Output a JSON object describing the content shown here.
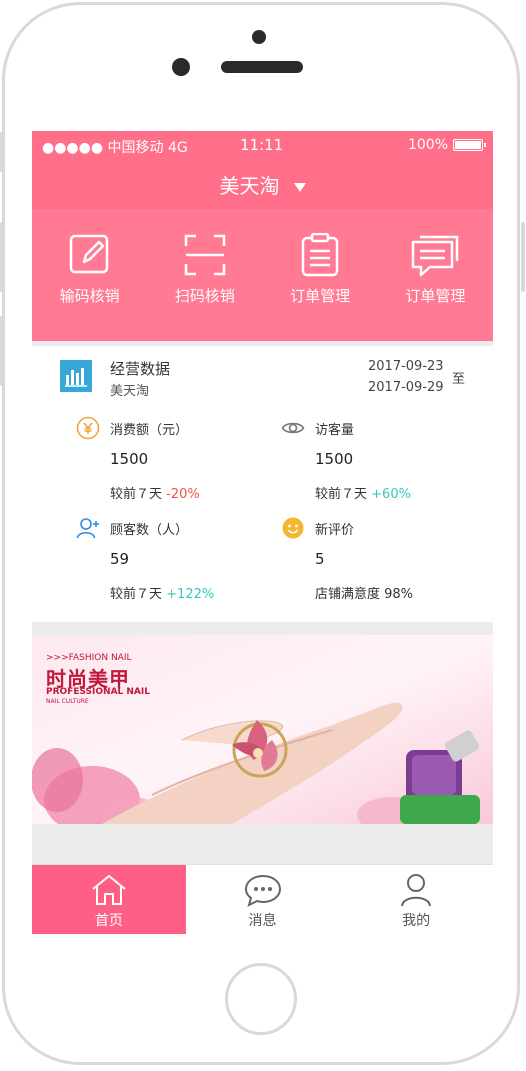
{
  "status_bar": {
    "carrier": "●●●●● 中国移动 4G",
    "time": "11:11",
    "battery": "100%"
  },
  "nav": {
    "title": "美天淘"
  },
  "quick_actions": [
    {
      "label": "输码核销",
      "icon": "edit-icon"
    },
    {
      "label": "扫码核销",
      "icon": "scan-icon"
    },
    {
      "label": "订单管理",
      "icon": "clipboard-icon"
    },
    {
      "label": "订单管理",
      "icon": "message-icon"
    }
  ],
  "stats": {
    "title": "经营数据",
    "subtitle": "美天淘",
    "date_start": "2017-09-23",
    "date_end": "2017-09-29",
    "to_label": "至",
    "metrics": [
      {
        "label": "消费额（元）",
        "value": "1500",
        "compare_prefix": "较前７天",
        "change": "-20%",
        "icon": "yuan-icon"
      },
      {
        "label": "访客量",
        "value": "1500",
        "compare_prefix": "较前７天",
        "change": "+60%",
        "icon": "eye-icon"
      },
      {
        "label": "顾客数（人）",
        "value": "59",
        "compare_prefix": "较前７天",
        "change": "+122%",
        "icon": "add-user-icon"
      },
      {
        "label": "新评价",
        "value": "5",
        "compare_prefix": "店铺满意度 98%",
        "change": "",
        "icon": "smile-icon"
      }
    ]
  },
  "banner": {
    "small_top": ">>>FASHION NAIL",
    "title": "时尚美甲",
    "sub": "PROFESSIONAL NAIL",
    "sub2": "NAIL CULTURE"
  },
  "tabbar": [
    {
      "label": "首页",
      "icon": "home-icon"
    },
    {
      "label": "消息",
      "icon": "chat-icon"
    },
    {
      "label": "我的",
      "icon": "person-icon"
    }
  ],
  "colors": {
    "brand": "#ff6f89",
    "header": "#ff7a92",
    "down": "#f0524a",
    "up": "#35c9ba"
  }
}
